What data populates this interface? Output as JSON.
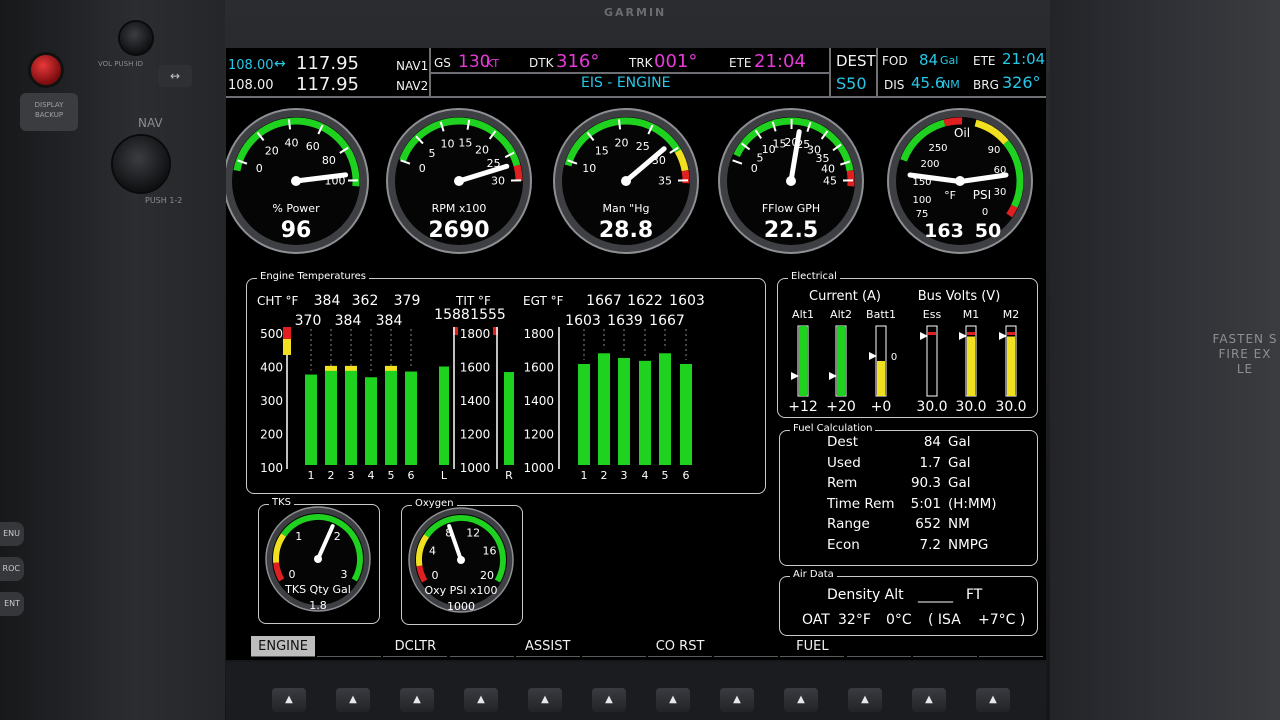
{
  "bezel": {
    "brand": "GARMIN",
    "display_backup_label": "DISPLAY BACKUP",
    "vol_label": "VOL PUSH ID",
    "nav_knob_label": "NAV",
    "push_label": "PUSH 1-2",
    "swap_label": "↔",
    "side_buttons": [
      "ENU",
      "ROC",
      "ENT"
    ],
    "right_placard": [
      "FASTEN S",
      "FIRE EX",
      "LE"
    ]
  },
  "header": {
    "nav1_active": "108.00",
    "nav1_swap": "↔",
    "nav1_standby": "117.95",
    "nav1_label": "NAV1",
    "nav2_active": "108.00",
    "nav2_standby": "117.95",
    "nav2_label": "NAV2",
    "gs_label": "GS",
    "gs_value": "130",
    "gs_unit": "KT",
    "dtk_label": "DTK",
    "dtk_value": "316°",
    "trk_label": "TRK",
    "trk_value": "001°",
    "ete_label": "ETE",
    "ete_value": "21:04",
    "page_title": "EIS - ENGINE",
    "dest_label": "DEST",
    "dest_id": "S50",
    "fod_label": "FOD",
    "fod_value": "84",
    "fod_unit": "Gal",
    "ete2_label": "ETE",
    "ete2_value": "21:04",
    "dis_label": "DIS",
    "dis_value": "45.6",
    "dis_unit": "NM",
    "brg_label": "BRG",
    "brg_value": "326°"
  },
  "gauges": [
    {
      "id": "power",
      "label": "% Power",
      "value": "96",
      "ticks": [
        "0",
        "20",
        "40",
        "60",
        "80",
        "100"
      ],
      "min": 0,
      "max": 100,
      "reading": 96
    },
    {
      "id": "rpm",
      "label": "RPM x100",
      "value": "2690",
      "ticks": [
        "0",
        "5",
        "10",
        "15",
        "20",
        "25",
        "30"
      ],
      "min": 0,
      "max": 30,
      "reading": 26.9
    },
    {
      "id": "map",
      "label": "Man \"Hg",
      "value": "28.8",
      "ticks": [
        "10",
        "15",
        "20",
        "25",
        "30",
        "35"
      ],
      "min": 10,
      "max": 35,
      "reading": 28.8
    },
    {
      "id": "ff",
      "label": "FFlow GPH",
      "value": "22.5",
      "ticks": [
        "0",
        "5",
        "10",
        "15",
        "20",
        "25",
        "30",
        "35",
        "40",
        "45"
      ],
      "min": 0,
      "max": 45,
      "reading": 22.5
    },
    {
      "id": "oil",
      "label": "Oil",
      "value_temp": "163",
      "value_psi": "50",
      "label_temp": "°F",
      "label_psi": "PSI",
      "ticks_temp": [
        "75",
        "100",
        "150",
        "200",
        "250"
      ],
      "ticks_psi": [
        "0",
        "30",
        "60",
        "90"
      ]
    }
  ],
  "engine_temps": {
    "title": "Engine Temperatures",
    "cht_label": "CHT °F",
    "tit_label": "TIT °F",
    "egt_label": "EGT °F",
    "cht_values_top": [
      "384",
      "362",
      "379"
    ],
    "cht_values_bottom": [
      "370",
      "384",
      "384"
    ],
    "tit_values": [
      "1588",
      "1555"
    ],
    "egt_values_top": [
      "1667",
      "1622",
      "1603"
    ],
    "egt_values_bottom": [
      "1603",
      "1639",
      "1667"
    ],
    "cht_scale": [
      "500",
      "400",
      "300",
      "200",
      "100"
    ],
    "tit_scale": [
      "1800",
      "1600",
      "1400",
      "1200",
      "1000"
    ],
    "egt_scale": [
      "1800",
      "1600",
      "1400",
      "1200",
      "1000"
    ],
    "cht_cyl_labels": [
      "1",
      "2",
      "3",
      "4",
      "5",
      "6"
    ],
    "tit_labels": [
      "L",
      "R"
    ],
    "egt_cyl_labels": [
      "1",
      "2",
      "3",
      "4",
      "5",
      "6"
    ],
    "cht": [
      370,
      384,
      384,
      362,
      384,
      379
    ],
    "tit": [
      1588,
      1555
    ],
    "egt": [
      1603,
      1667,
      1639,
      1622,
      1667,
      1603
    ]
  },
  "electrical": {
    "title": "Electrical",
    "current_label": "Current (A)",
    "volts_label": "Bus Volts (V)",
    "bars": [
      {
        "name": "Alt1",
        "value": "+12",
        "fill": 1.0,
        "color": "#1fd21f"
      },
      {
        "name": "Alt2",
        "value": "+20",
        "fill": 1.0,
        "color": "#1fd21f"
      },
      {
        "name": "Batt1",
        "value": "+0",
        "fill": 0.5,
        "color": "#f0e020"
      },
      {
        "name": "Ess",
        "value": "30.0",
        "fill": 0.0,
        "color": "#f0e020"
      },
      {
        "name": "M1",
        "value": "30.0",
        "fill": 0.85,
        "color": "#f0e020"
      },
      {
        "name": "M2",
        "value": "30.0",
        "fill": 0.85,
        "color": "#f0e020"
      }
    ],
    "batt_zero": "0"
  },
  "fuel_calc": {
    "title": "Fuel Calculation",
    "rows": [
      {
        "label": "Dest",
        "value": "84",
        "unit": "Gal"
      },
      {
        "label": "Used",
        "value": "1.7",
        "unit": "Gal"
      },
      {
        "label": "Rem",
        "value": "90.3",
        "unit": "Gal"
      },
      {
        "label": "Time Rem",
        "value": "5:01",
        "unit": "(H:MM)"
      },
      {
        "label": "Range",
        "value": "652",
        "unit": "NM"
      },
      {
        "label": "Econ",
        "value": "7.2",
        "unit": "NMPG"
      }
    ]
  },
  "air_data": {
    "title": "Air Data",
    "density_alt_label": "Density Alt",
    "density_alt_value": "_____",
    "density_alt_unit": "FT",
    "oat_label": "OAT",
    "oat_f": "32°F",
    "oat_c": "0°C",
    "isa": "( ISA",
    "isa_dev": "+7°C )"
  },
  "tks": {
    "title": "TKS",
    "label": "TKS Qty Gal",
    "value": "1.8",
    "ticks": [
      "0",
      "1",
      "2",
      "3"
    ]
  },
  "oxygen": {
    "title": "Oxygen",
    "label": "Oxy PSI x100",
    "value": "1000",
    "ticks": [
      "0",
      "4",
      "8",
      "12",
      "16",
      "20"
    ]
  },
  "softkeys": [
    "ENGINE",
    "",
    "DCLTR",
    "",
    "ASSIST",
    "",
    "CO RST",
    "",
    "FUEL",
    "",
    "",
    ""
  ],
  "hw_button_glyph": "▲",
  "colors": {
    "cyan": "#27c7e8",
    "magenta": "#e63ad8",
    "green": "#1fd21f",
    "yellow": "#f0e020",
    "red": "#e02020"
  }
}
